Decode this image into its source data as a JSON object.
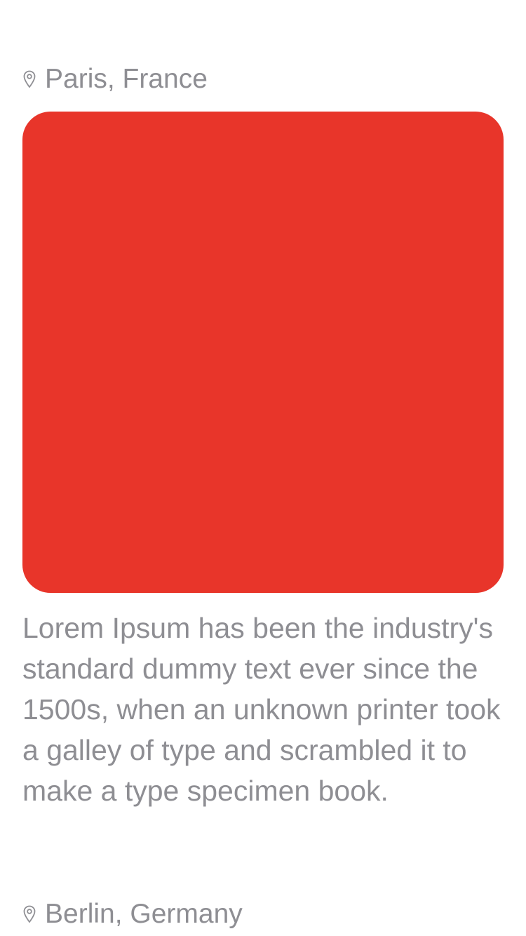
{
  "feed": {
    "items": [
      {
        "location": "Paris, France",
        "location_icon": "map-pin-icon",
        "image_color": "#E8352A",
        "description": "Lorem Ipsum has been the industry's standard dummy text ever since the 1500s, when an unknown printer took a galley of type and scrambled it to make a type specimen book."
      },
      {
        "location": "Berlin, Germany",
        "location_icon": "map-pin-icon"
      }
    ]
  },
  "colors": {
    "text_secondary": "#8E8E93",
    "background": "#FFFFFF"
  }
}
